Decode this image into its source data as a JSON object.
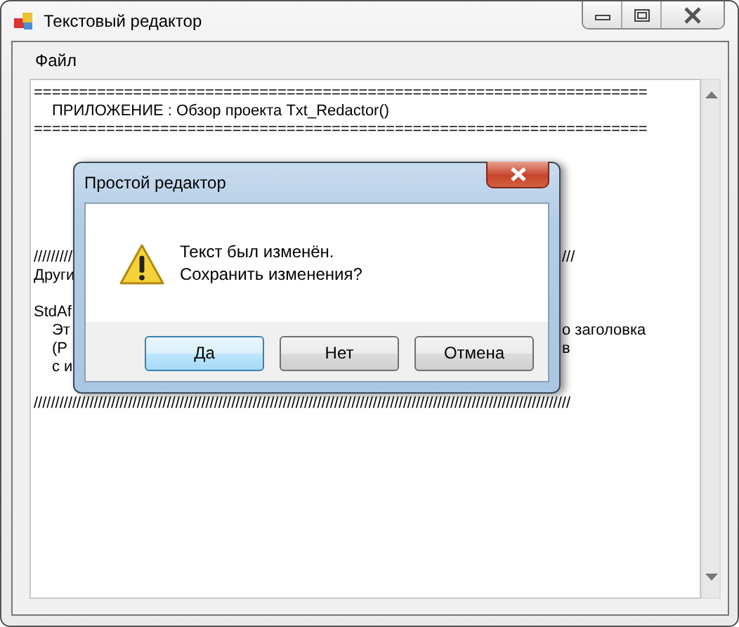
{
  "window": {
    "title": "Текстовый редактор"
  },
  "menu": [
    {
      "label": "Файл"
    }
  ],
  "editor": {
    "lines": [
      {
        "kind": "full",
        "text": "===================================================================="
      },
      {
        "kind": "full",
        "indent": true,
        "text": "ПРИЛОЖЕНИЕ : Обзор проекта Txt_Redactor()"
      },
      {
        "kind": "full",
        "text": "===================================================================="
      },
      {
        "kind": "blank"
      },
      {
        "kind": "blank"
      },
      {
        "kind": "blank"
      },
      {
        "kind": "blank"
      },
      {
        "kind": "blank"
      },
      {
        "kind": "blank"
      },
      {
        "kind": "split",
        "left": "/////////",
        "right": "///"
      },
      {
        "kind": "split",
        "left": "Други"
      },
      {
        "kind": "blank"
      },
      {
        "kind": "split",
        "left": "StdAf"
      },
      {
        "kind": "split",
        "indent": true,
        "left": "Эт",
        "right": "о заголовка"
      },
      {
        "kind": "split",
        "indent": true,
        "left": "(P",
        "right": "в"
      },
      {
        "kind": "split",
        "indent": true,
        "left": "с и"
      },
      {
        "kind": "blank"
      },
      {
        "kind": "full",
        "text": "/////////////////////////////////////////////////////////////////////////////////////////////////////////////////////////////"
      }
    ]
  },
  "dialog": {
    "title": "Простой редактор",
    "message": [
      "Текст был изменён.",
      "Сохранить изменения?"
    ],
    "buttons": [
      {
        "label": "Да",
        "default": true
      },
      {
        "label": "Нет",
        "default": false
      },
      {
        "label": "Отмена",
        "default": false
      }
    ]
  }
}
